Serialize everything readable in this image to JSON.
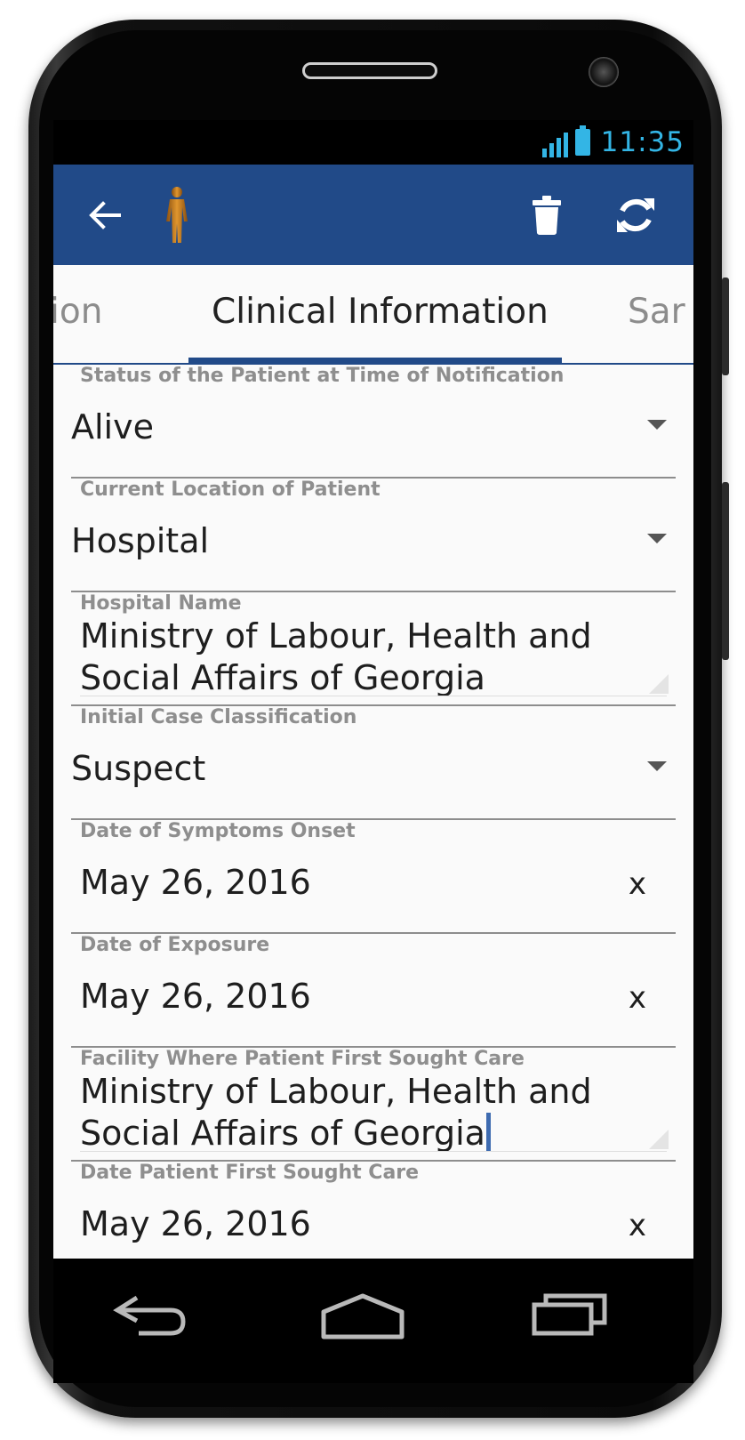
{
  "status_bar": {
    "time": "11:35"
  },
  "tabs": {
    "prev_partial": "ion",
    "active": "Clinical Information",
    "next_partial": "Sar"
  },
  "colors": {
    "app_bar": "#214a88",
    "status_accent": "#33b5e5",
    "patient_icon": "#c47a1e"
  },
  "icons": [
    "back-arrow-icon",
    "person-icon",
    "trash-icon",
    "sync-icon",
    "nav-back-icon",
    "nav-home-icon",
    "nav-recents-icon"
  ],
  "form": {
    "status_at_notification": {
      "label": "Status of the Patient at Time of Notification",
      "value": "Alive"
    },
    "current_location": {
      "label": "Current Location of Patient",
      "value": "Hospital"
    },
    "hospital_name": {
      "label": "Hospital Name",
      "value_line1": "Ministry of Labour, Health and",
      "value_line2": "Social Affairs of Georgia"
    },
    "initial_classification": {
      "label": "Initial Case Classification",
      "value": "Suspect"
    },
    "symptoms_onset": {
      "label": "Date of Symptoms Onset",
      "value": "May 26, 2016",
      "clear": "x"
    },
    "exposure_date": {
      "label": "Date of Exposure",
      "value": "May 26, 2016",
      "clear": "x"
    },
    "first_care_facility": {
      "label": "Facility Where Patient First Sought Care",
      "value_line1": "Ministry of Labour, Health and",
      "value_line2": "Social Affairs of Georgia"
    },
    "first_care_date": {
      "label": "Date Patient First Sought Care",
      "value": "May 26, 2016",
      "clear": "x"
    }
  }
}
